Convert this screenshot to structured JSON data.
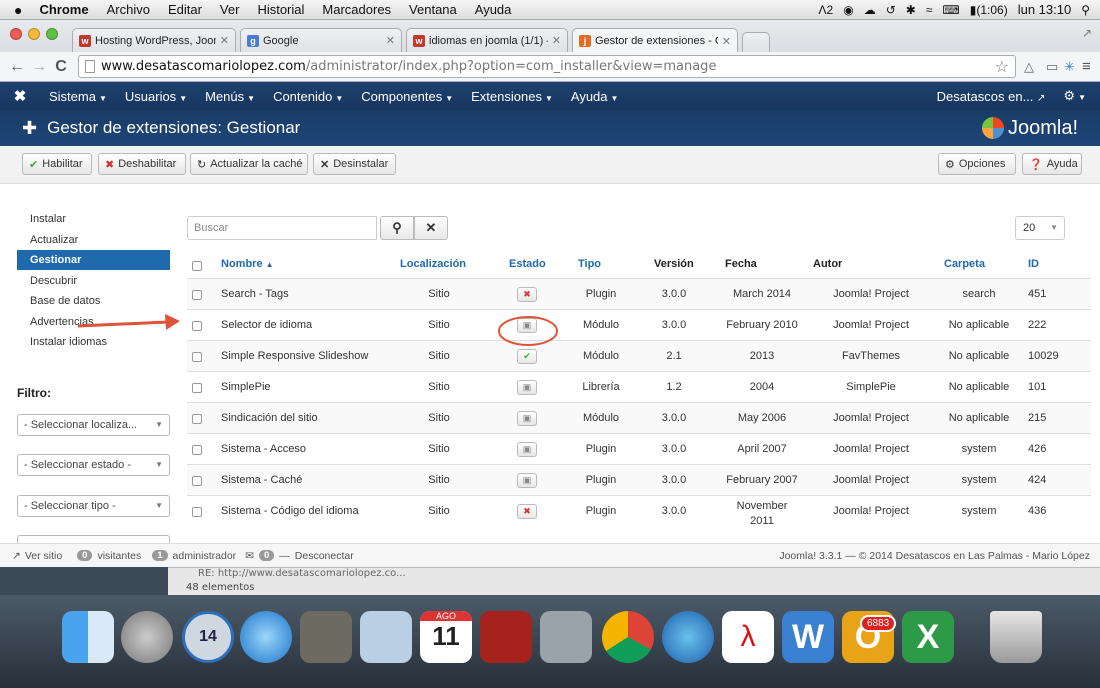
{
  "mac_menu": {
    "app": "Chrome",
    "items": [
      "Archivo",
      "Editar",
      "Ver",
      "Historial",
      "Marcadores",
      "Ventana",
      "Ayuda"
    ],
    "status_ai": "2",
    "battery": "(1:06)",
    "clock": "lun 13:10"
  },
  "tabs": [
    {
      "title": "Hosting WordPress, Jooml",
      "fav": "w",
      "color": "#c0392b"
    },
    {
      "title": "Google",
      "fav": "g",
      "color": "#4b7bd6"
    },
    {
      "title": "idiomas en joomla (1/1) –",
      "fav": "w",
      "color": "#c0392b"
    },
    {
      "title": "Gestor de extensiones - C",
      "fav": "j",
      "color": "#e26b26"
    }
  ],
  "address": {
    "host": "www.desatascomariolopez.com",
    "path": "/administrator/index.php?option=com_installer&view=manage"
  },
  "nav": {
    "items": [
      "Sistema",
      "Usuarios",
      "Menús",
      "Contenido",
      "Componentes",
      "Extensiones",
      "Ayuda"
    ],
    "site": "Desatascos en..."
  },
  "header": {
    "title": "Gestor de extensiones: Gestionar",
    "logo": "Joomla!"
  },
  "toolbar": {
    "enable": "Habilitar",
    "disable": "Deshabilitar",
    "refresh": "Actualizar la caché",
    "uninstall": "Desinstalar",
    "options": "Opciones",
    "help": "Ayuda"
  },
  "sidebar": {
    "items": [
      "Instalar",
      "Actualizar",
      "Gestionar",
      "Descubrir",
      "Base de datos",
      "Advertencias",
      "Instalar idiomas"
    ],
    "filter_label": "Filtro:",
    "filters": [
      "- Seleccionar localiza...",
      "- Seleccionar estado -",
      "- Seleccionar tipo -"
    ]
  },
  "search": {
    "placeholder": "Buscar"
  },
  "limit": "20",
  "columns": {
    "name": "Nombre",
    "location": "Localización",
    "state": "Estado",
    "type": "Tipo",
    "version": "Versión",
    "date": "Fecha",
    "author": "Autor",
    "folder": "Carpeta",
    "id": "ID"
  },
  "rows": [
    {
      "name": "Search - Tags",
      "location": "Sitio",
      "state": "disabled",
      "type": "Plugin",
      "version": "3.0.0",
      "date": "March 2014",
      "author": "Joomla! Project",
      "folder": "search",
      "id": "451"
    },
    {
      "name": "Selector de idioma",
      "location": "Sitio",
      "state": "locked",
      "type": "Módulo",
      "version": "3.0.0",
      "date": "February 2010",
      "author": "Joomla! Project",
      "folder": "No aplicable",
      "id": "222"
    },
    {
      "name": "Simple Responsive Slideshow",
      "location": "Sitio",
      "state": "enabled",
      "type": "Módulo",
      "version": "2.1",
      "date": "2013",
      "author": "FavThemes",
      "folder": "No aplicable",
      "id": "10029"
    },
    {
      "name": "SimplePie",
      "location": "Sitio",
      "state": "locked",
      "type": "Librería",
      "version": "1.2",
      "date": "2004",
      "author": "SimplePie",
      "folder": "No aplicable",
      "id": "101"
    },
    {
      "name": "Sindicación del sitio",
      "location": "Sitio",
      "state": "locked",
      "type": "Módulo",
      "version": "3.0.0",
      "date": "May 2006",
      "author": "Joomla! Project",
      "folder": "No aplicable",
      "id": "215"
    },
    {
      "name": "Sistema - Acceso",
      "location": "Sitio",
      "state": "locked",
      "type": "Plugin",
      "version": "3.0.0",
      "date": "April 2007",
      "author": "Joomla! Project",
      "folder": "system",
      "id": "426"
    },
    {
      "name": "Sistema - Caché",
      "location": "Sitio",
      "state": "locked",
      "type": "Plugin",
      "version": "3.0.0",
      "date": "February 2007",
      "author": "Joomla! Project",
      "folder": "system",
      "id": "424"
    },
    {
      "name": "Sistema - Código del idioma",
      "location": "Sitio",
      "state": "disabled",
      "type": "Plugin",
      "version": "3.0.0",
      "date": "November\n2011",
      "author": "Joomla! Project",
      "folder": "system",
      "id": "436"
    }
  ],
  "status": {
    "view_site": "Ver sitio",
    "visitors_count": "0",
    "visitors": "visitantes",
    "admins_count": "1",
    "admins": "administrador",
    "messages_count": "0",
    "logout": "Desconectar",
    "footer": "Joomla! 3.3.1  —  © 2014 Desatascos en Las Palmas - Mario López"
  },
  "below": {
    "line1": "RE: http://www.desatascomariolopez.co...",
    "line2": "48 elementos"
  },
  "dock": {
    "calendar_month": "AGO",
    "calendar_day": "11",
    "clock_day": "14",
    "badge": "6883"
  },
  "colors": {
    "joomla_nav": "#1d416d",
    "accent": "#1f6aad",
    "annotation": "#e0533b"
  }
}
